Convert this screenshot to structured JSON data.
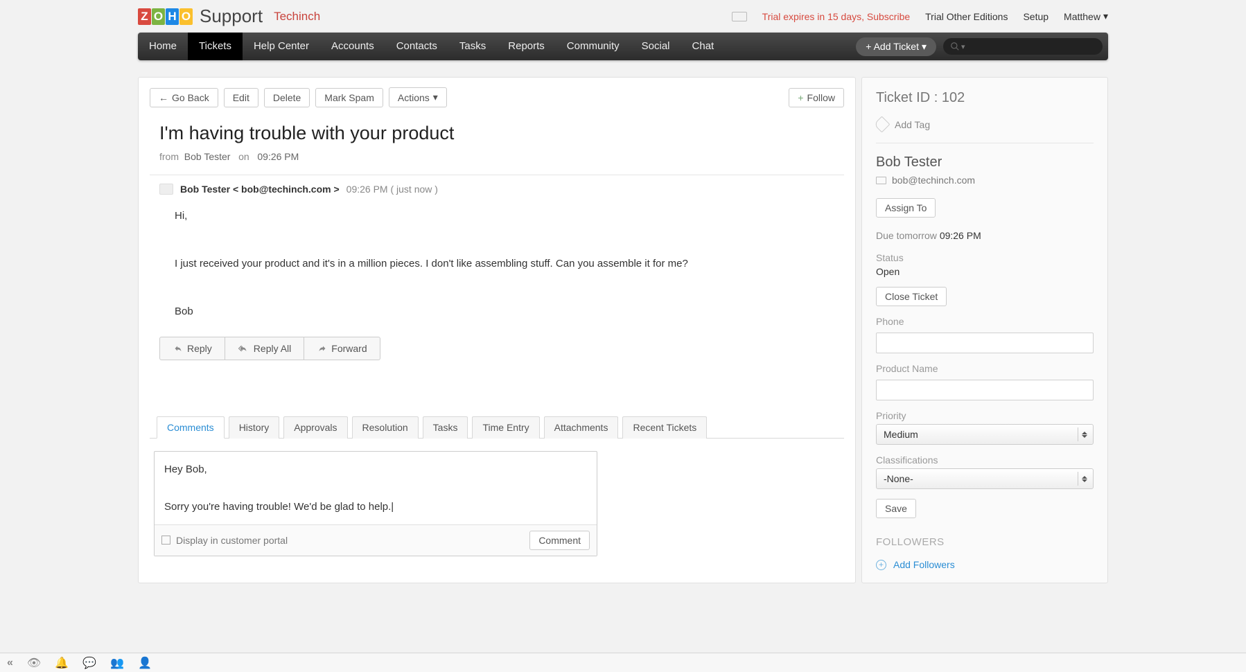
{
  "header": {
    "support_label": "Support",
    "org": "Techinch",
    "trial": "Trial expires in 15 days, Subscribe",
    "trial_other": "Trial Other Editions",
    "setup": "Setup",
    "user": "Matthew"
  },
  "nav": {
    "items": [
      "Home",
      "Tickets",
      "Help Center",
      "Accounts",
      "Contacts",
      "Tasks",
      "Reports",
      "Community",
      "Social",
      "Chat"
    ],
    "active_index": 1,
    "add_ticket": "+ Add Ticket"
  },
  "actions": {
    "go_back": "Go Back",
    "edit": "Edit",
    "delete": "Delete",
    "mark_spam": "Mark Spam",
    "actions": "Actions",
    "follow": "Follow"
  },
  "ticket": {
    "title": "I'm having trouble with your product",
    "from_label": "from",
    "from_name": "Bob Tester",
    "on_label": "on",
    "on_time": "09:26 PM"
  },
  "thread": {
    "sender": "Bob Tester < bob@techinch.com >",
    "time": "09:26 PM ( just now )",
    "body": "Hi,\n\nI just received your product and it's in a million pieces. I don't like assembling stuff. Can you assemble it for me?\n\nBob",
    "reply": "Reply",
    "reply_all": "Reply All",
    "forward": "Forward"
  },
  "tabs": [
    "Comments",
    "History",
    "Approvals",
    "Resolution",
    "Tasks",
    "Time Entry",
    "Attachments",
    "Recent Tickets"
  ],
  "tabs_active_index": 0,
  "comment": {
    "draft": "Hey Bob,\n\nSorry you're having trouble! We'd be glad to help.|",
    "display_portal": "Display in customer portal",
    "comment_btn": "Comment"
  },
  "side": {
    "ticket_id_label": "Ticket ID : 102",
    "add_tag": "Add Tag",
    "contact_name": "Bob Tester",
    "contact_email": "bob@techinch.com",
    "assign_to": "Assign To",
    "due_label": "Due tomorrow",
    "due_time": "09:26 PM",
    "status_label": "Status",
    "status_value": "Open",
    "close_ticket": "Close Ticket",
    "phone_label": "Phone",
    "phone_value": "",
    "product_label": "Product Name",
    "product_value": "",
    "priority_label": "Priority",
    "priority_value": "Medium",
    "class_label": "Classifications",
    "class_value": "-None-",
    "save": "Save",
    "followers_label": "FOLLOWERS",
    "add_followers": "Add Followers"
  }
}
